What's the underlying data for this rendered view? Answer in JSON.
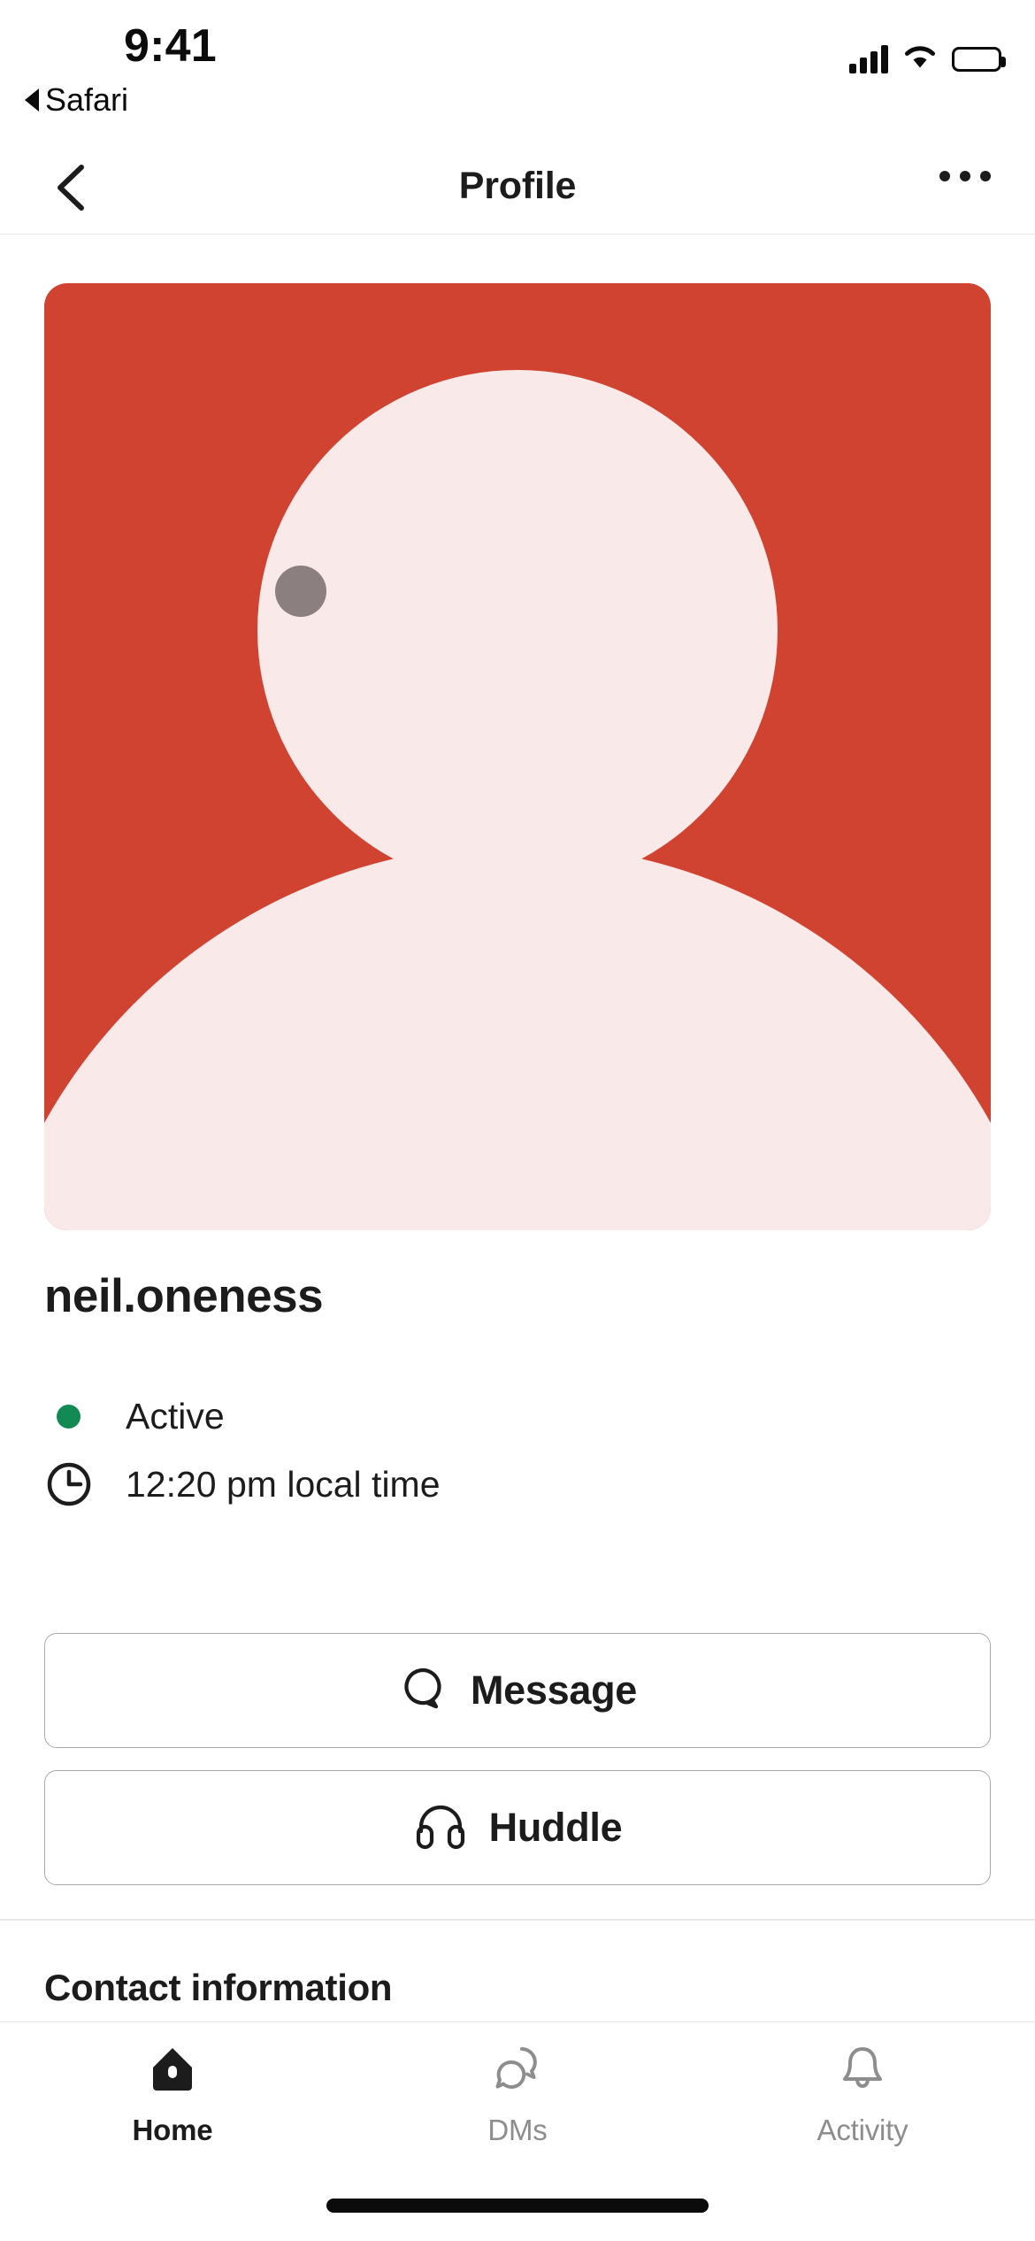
{
  "status_bar": {
    "time": "9:41",
    "back_app_label": "Safari",
    "icons": [
      "cellular-signal-icon",
      "wifi-icon",
      "battery-icon"
    ]
  },
  "nav_bar": {
    "back_icon": "chevron-left-icon",
    "title": "Profile",
    "overflow_icon": "more-horizontal-icon"
  },
  "profile": {
    "avatar": {
      "icon": "default-user-avatar",
      "background_color": "#D14331",
      "figure_color": "#FAE9E9"
    },
    "username": "neil.oneness",
    "presence": {
      "icon": "presence-active-dot",
      "color": "#128A53",
      "label": "Active"
    },
    "local_time": {
      "icon": "clock-icon",
      "label": "12:20 pm local time"
    }
  },
  "actions": [
    {
      "id": "message",
      "icon": "speech-bubble-icon",
      "label": "Message"
    },
    {
      "id": "huddle",
      "icon": "headphones-icon",
      "label": "Huddle"
    }
  ],
  "contact_section": {
    "heading": "Contact information"
  },
  "tab_bar": {
    "items": [
      {
        "id": "home",
        "icon": "home-icon",
        "label": "Home",
        "active": true
      },
      {
        "id": "dms",
        "icon": "dms-icon",
        "label": "DMs",
        "active": false
      },
      {
        "id": "activity",
        "icon": "bell-icon",
        "label": "Activity",
        "active": false
      }
    ]
  },
  "home_indicator": "home-indicator-bar"
}
